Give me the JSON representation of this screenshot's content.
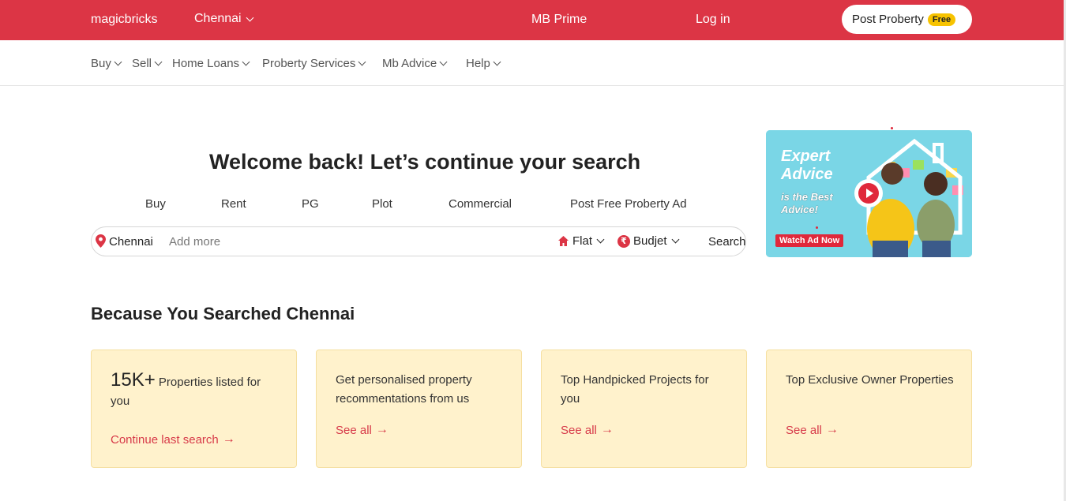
{
  "topbar": {
    "brand": "magicbricks",
    "city": "Chennai",
    "prime": "MB Prime",
    "login": "Log in",
    "post_label": "Post Proberty",
    "free_badge": "Free"
  },
  "subnav": {
    "items": [
      {
        "label": "Buy"
      },
      {
        "label": "Sell"
      },
      {
        "label": "Home Loans"
      },
      {
        "label": "Proberty Services"
      },
      {
        "label": "Mb Advice"
      },
      {
        "label": "Help"
      }
    ]
  },
  "hero": {
    "title": "Welcome back! Let’s continue your search",
    "tabs": [
      "Buy",
      "Rent",
      "PG",
      "Plot",
      "Commercial",
      "Post Free Proberty Ad"
    ]
  },
  "search": {
    "city": "Chennai",
    "placeholder": "Add more",
    "type": "Flat",
    "budget": "Budjet",
    "button": "Search"
  },
  "ad": {
    "title_line1": "Expert",
    "title_line2": "Advice",
    "sub_line1": "is the Best",
    "sub_line2": "Advice!",
    "cta": "Watch Ad Now"
  },
  "section": {
    "title": "Because You Searched Chennai",
    "cards": [
      {
        "big": "15K+",
        "text": "Properties listed for you",
        "link": "Continue last search"
      },
      {
        "text": "Get personalised property recommentations from us",
        "link": "See all"
      },
      {
        "text": "Top Handpicked Projects for you",
        "link": "See all"
      },
      {
        "text": "Top Exclusive Owner Properties",
        "link": "See all"
      }
    ]
  },
  "colors": {
    "brand_red": "#dc3545",
    "card_bg": "#fff2cc",
    "badge_yellow": "#f7c300"
  }
}
